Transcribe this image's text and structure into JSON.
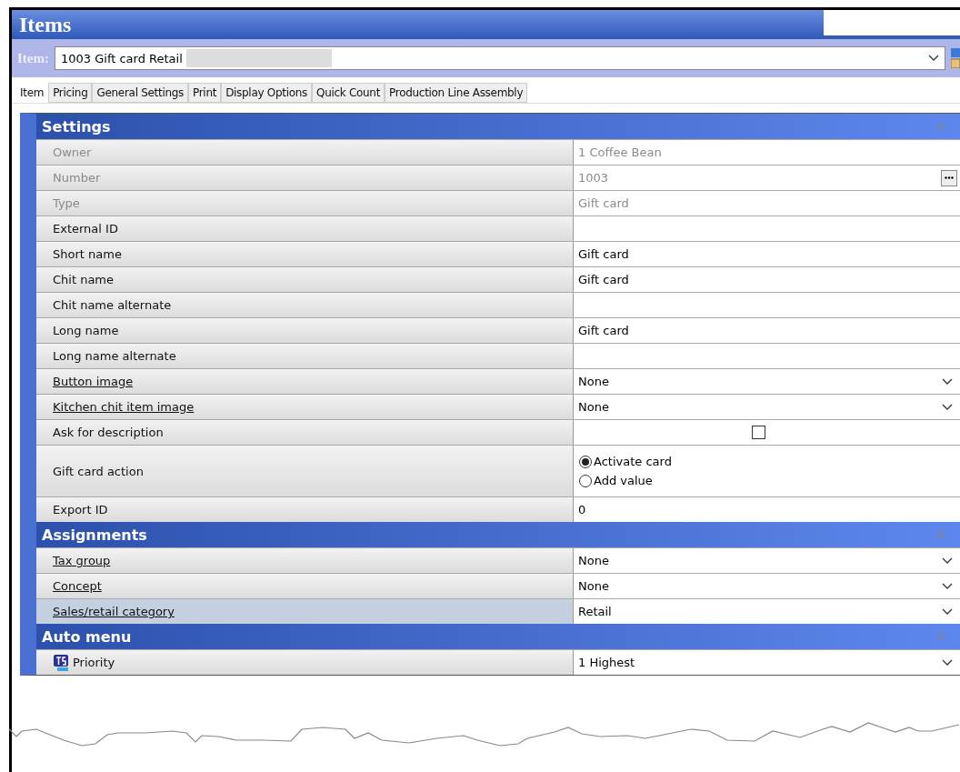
{
  "window": {
    "title": "Items"
  },
  "item_selector": {
    "label": "Item:",
    "value": "1003 Gift card Retail",
    "redacted": true
  },
  "tabs": [
    {
      "label": "Item",
      "selected": true
    },
    {
      "label": "Pricing",
      "selected": false
    },
    {
      "label": "General Settings",
      "selected": false
    },
    {
      "label": "Print",
      "selected": false
    },
    {
      "label": "Display Options",
      "selected": false
    },
    {
      "label": "Quick Count",
      "selected": false
    },
    {
      "label": "Production Line Assembly",
      "selected": false
    }
  ],
  "sections": [
    {
      "title": "Settings",
      "expanded": true,
      "rows": [
        {
          "label": "Owner",
          "kind": "text",
          "value": "1  Coffee Bean",
          "disabled": true,
          "link": false,
          "selected": false
        },
        {
          "label": "Number",
          "kind": "ellipsis",
          "value": "1003",
          "disabled": true,
          "link": false,
          "selected": false
        },
        {
          "label": "Type",
          "kind": "text",
          "value": "Gift card",
          "disabled": true,
          "link": false,
          "selected": false
        },
        {
          "label": "External ID",
          "kind": "text",
          "disabled": false,
          "link": false,
          "selected": false
        },
        {
          "label": "Short name",
          "kind": "text",
          "value": "Gift card",
          "disabled": false,
          "link": false,
          "selected": false
        },
        {
          "label": "Chit name",
          "kind": "text",
          "value": "Gift card",
          "disabled": false,
          "link": false,
          "selected": false
        },
        {
          "label": "Chit name alternate",
          "kind": "text",
          "disabled": false,
          "link": false,
          "selected": false
        },
        {
          "label": "Long name",
          "kind": "text",
          "value": "Gift card",
          "disabled": false,
          "link": false,
          "selected": false
        },
        {
          "label": "Long name alternate",
          "kind": "text",
          "disabled": false,
          "link": false,
          "selected": false
        },
        {
          "label": "Button image",
          "kind": "dropdown",
          "value": "None",
          "disabled": false,
          "link": true,
          "selected": false
        },
        {
          "label": "Kitchen chit item image",
          "kind": "dropdown",
          "value": "None",
          "disabled": false,
          "link": true,
          "selected": false
        },
        {
          "label": "Ask for description",
          "kind": "checkbox",
          "checked": false,
          "disabled": false,
          "link": false,
          "selected": false
        },
        {
          "label": "Gift card action",
          "kind": "radio",
          "options": [
            {
              "label": "Activate card",
              "selected": true
            },
            {
              "label": "Add value",
              "selected": false
            }
          ],
          "disabled": false,
          "link": false,
          "selected": false
        },
        {
          "label": "Export ID",
          "kind": "text",
          "value": "0",
          "disabled": false,
          "link": false,
          "selected": false
        }
      ]
    },
    {
      "title": "Assignments",
      "expanded": true,
      "rows": [
        {
          "label": "Tax group",
          "kind": "dropdown",
          "value": "None",
          "disabled": false,
          "link": true,
          "selected": false
        },
        {
          "label": "Concept",
          "kind": "dropdown",
          "value": "None",
          "disabled": false,
          "link": true,
          "selected": false
        },
        {
          "label": "Sales/retail category",
          "kind": "dropdown",
          "value": "Retail",
          "disabled": false,
          "link": true,
          "selected": true
        }
      ]
    },
    {
      "title": "Auto menu",
      "expanded": true,
      "rows": [
        {
          "label": "Priority",
          "kind": "dropdown",
          "value": "1 Highest",
          "disabled": false,
          "link": false,
          "selected": false,
          "icon": true
        }
      ]
    }
  ]
}
